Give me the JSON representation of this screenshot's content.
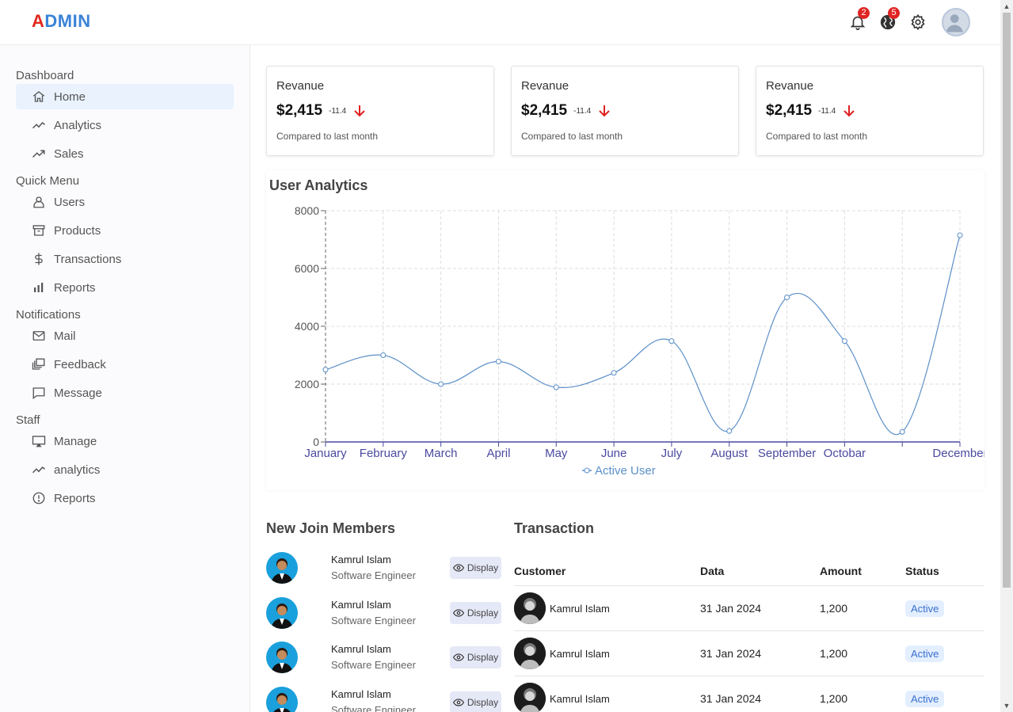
{
  "brand": {
    "first_letter": "A",
    "rest": "DMIN"
  },
  "topbar": {
    "notifications_count": "2",
    "language_count": "5",
    "icons": [
      "bell-icon",
      "globe-icon",
      "gear-icon",
      "user-avatar"
    ]
  },
  "sidebar": {
    "sections": [
      {
        "title": "Dashboard",
        "items": [
          {
            "label": "Home",
            "icon": "home-icon",
            "active": true
          },
          {
            "label": "Analytics",
            "icon": "line-chart-icon"
          },
          {
            "label": "Sales",
            "icon": "trending-up-icon"
          }
        ]
      },
      {
        "title": "Quick Menu",
        "items": [
          {
            "label": "Users",
            "icon": "user-icon"
          },
          {
            "label": "Products",
            "icon": "archive-icon"
          },
          {
            "label": "Transactions",
            "icon": "dollar-icon"
          },
          {
            "label": "Reports",
            "icon": "bar-chart-icon"
          }
        ]
      },
      {
        "title": "Notifications",
        "items": [
          {
            "label": "Mail",
            "icon": "mail-icon"
          },
          {
            "label": "Feedback",
            "icon": "feedback-icon"
          },
          {
            "label": "Message",
            "icon": "message-icon"
          }
        ]
      },
      {
        "title": "Staff",
        "items": [
          {
            "label": "Manage",
            "icon": "monitor-icon"
          },
          {
            "label": "analytics",
            "icon": "line-chart-icon"
          },
          {
            "label": "Reports",
            "icon": "alert-circle-icon"
          }
        ]
      }
    ]
  },
  "cards": [
    {
      "title": "Revanue",
      "amount": "$2,415",
      "rate": "-11.4",
      "sub": "Compared to last month"
    },
    {
      "title": "Revanue",
      "amount": "$2,415",
      "rate": "-11.4",
      "sub": "Compared to last month"
    },
    {
      "title": "Revanue",
      "amount": "$2,415",
      "rate": "-11.4",
      "sub": "Compared to last month"
    }
  ],
  "colors": {
    "accent": "#3a83d6",
    "brand_red": "#e0281e",
    "line": "#5b8fc7",
    "axis_text": "#4a4aa0",
    "down_arrow": "#e02020"
  },
  "chart_data": {
    "type": "line",
    "title": "User Analytics",
    "categories": [
      "January",
      "February",
      "March",
      "April",
      "May",
      "June",
      "July",
      "August",
      "September",
      "Octobar",
      "",
      "December"
    ],
    "series": [
      {
        "name": "Active User",
        "values": [
          2500,
          3000,
          2000,
          2780,
          1890,
          2390,
          3490,
          380,
          5000,
          3490,
          350,
          7150
        ]
      }
    ],
    "ylim": [
      0,
      8000
    ],
    "yticks": [
      0,
      2000,
      4000,
      6000,
      8000
    ],
    "grid": true,
    "legend": "bottom"
  },
  "members": {
    "title": "New Join Members",
    "button_label": "Display",
    "items": [
      {
        "name": "Kamrul Islam",
        "role": "Software Engineer"
      },
      {
        "name": "Kamrul Islam",
        "role": "Software Engineer"
      },
      {
        "name": "Kamrul Islam",
        "role": "Software Engineer"
      },
      {
        "name": "Kamrul Islam",
        "role": "Software Engineer"
      }
    ]
  },
  "transactions": {
    "title": "Transaction",
    "headers": [
      "Customer",
      "Data",
      "Amount",
      "Status"
    ],
    "rows": [
      {
        "customer": "Kamrul Islam",
        "date": "31 Jan 2024",
        "amount": "1,200",
        "status": "Active"
      },
      {
        "customer": "Kamrul Islam",
        "date": "31 Jan 2024",
        "amount": "1,200",
        "status": "Active"
      },
      {
        "customer": "Kamrul Islam",
        "date": "31 Jan 2024",
        "amount": "1,200",
        "status": "Active"
      }
    ]
  }
}
